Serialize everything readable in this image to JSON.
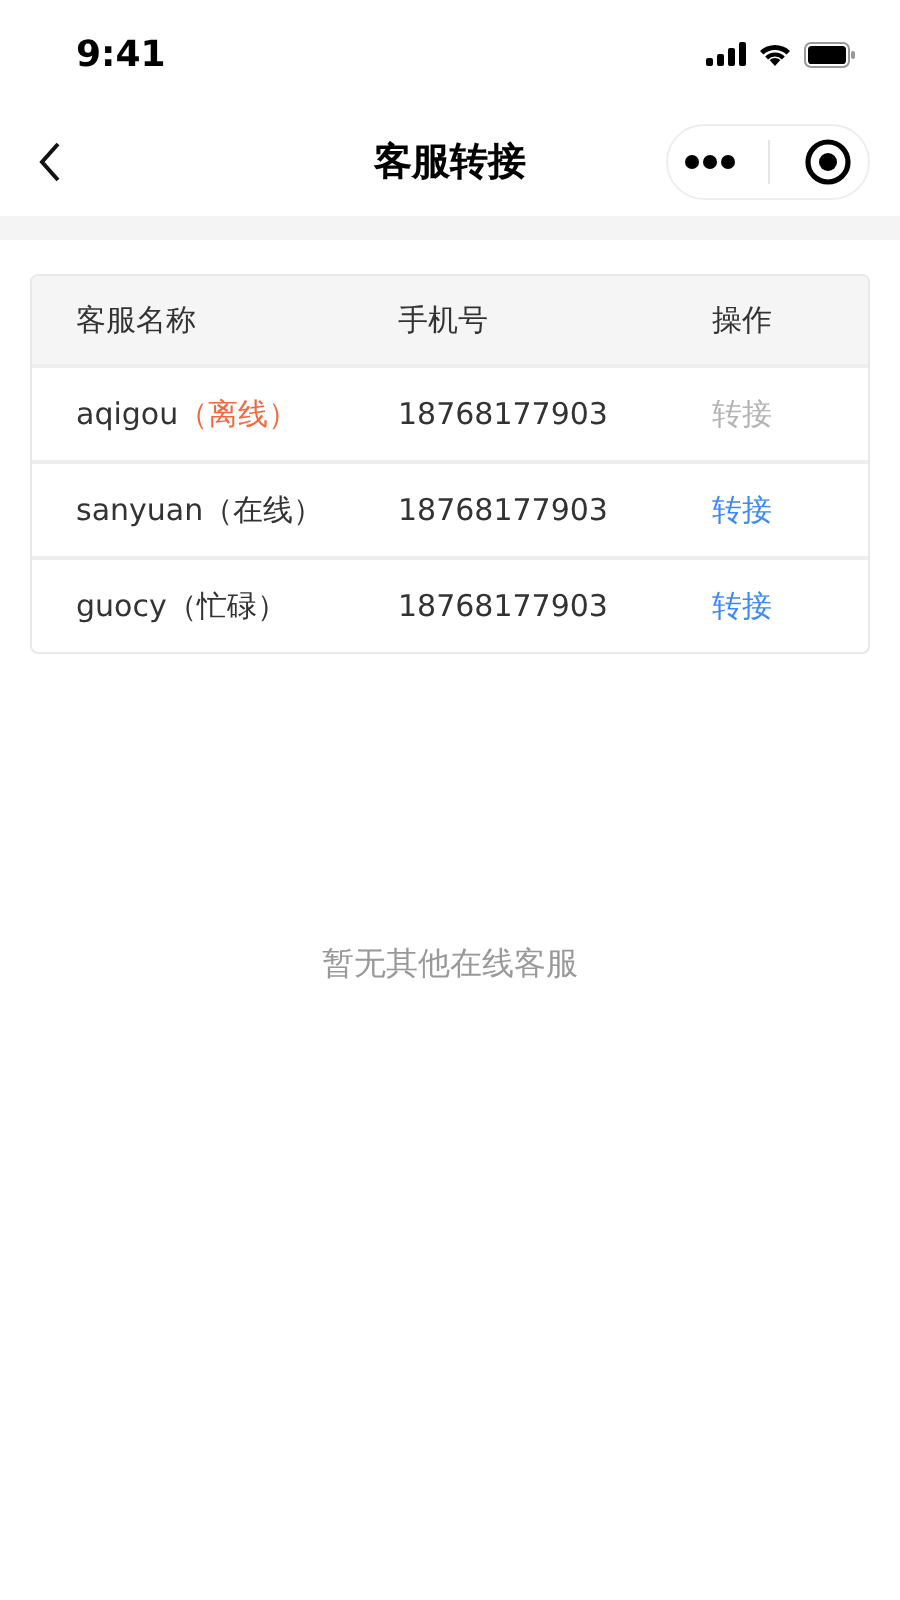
{
  "status_bar": {
    "time": "9:41"
  },
  "nav": {
    "title": "客服转接"
  },
  "table": {
    "columns": [
      "客服名称",
      "手机号",
      "操作"
    ],
    "rows": [
      {
        "name": "aqigou",
        "status": "（离线）",
        "color": "#f5683f",
        "phone": "18768177903",
        "action": "转接",
        "disabled": true
      },
      {
        "name": "sanyuan",
        "status": "（在线）",
        "color": "#333333",
        "phone": "18768177903",
        "action": "转接",
        "disabled": false
      },
      {
        "name": "guocy",
        "status": "（忙碌）",
        "color": "#333333",
        "phone": "18768177903",
        "action": "转接",
        "disabled": false
      }
    ]
  },
  "empty_message": "暂无其他在线客服"
}
